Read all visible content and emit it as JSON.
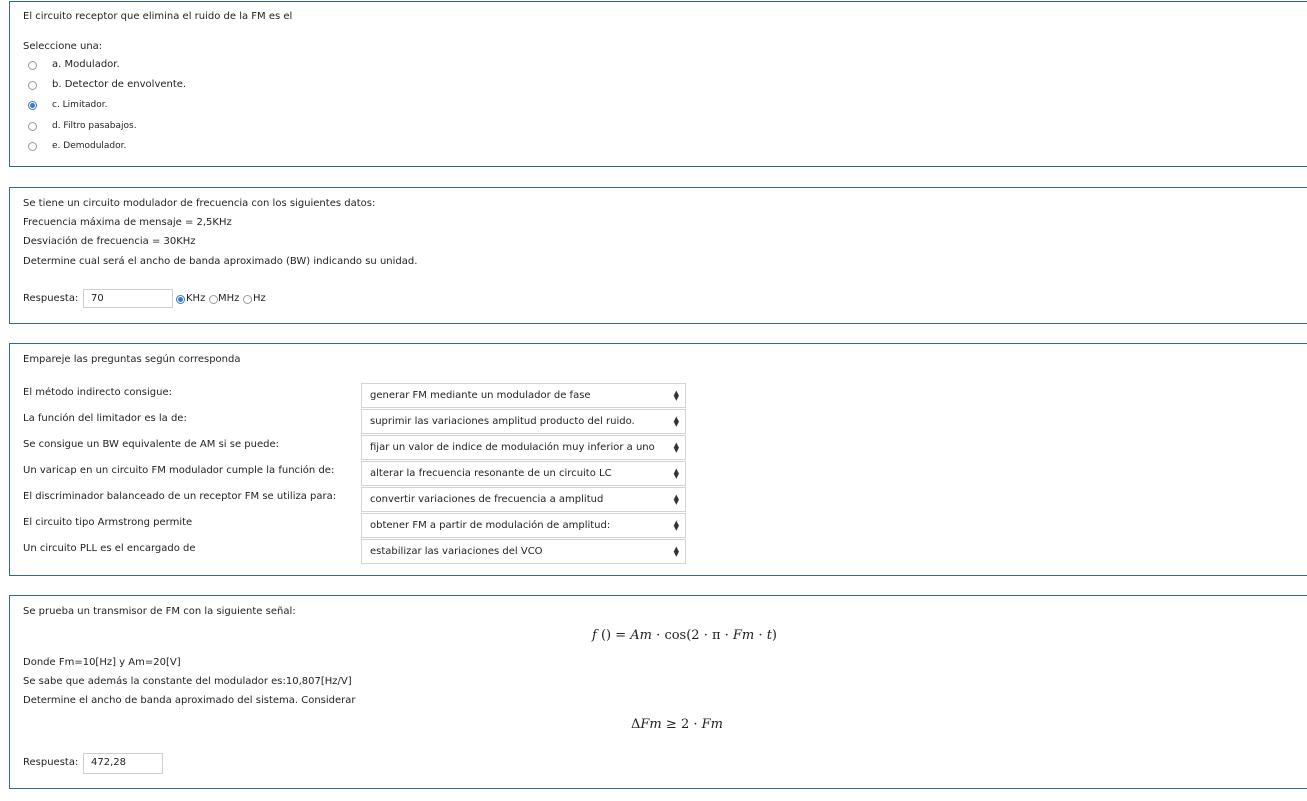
{
  "q1": {
    "prompt": "El circuito receptor que elimina el ruido de la FM es el",
    "select_label": "Seleccione una:",
    "options": [
      {
        "text": "a.  Modulador.",
        "selected": false
      },
      {
        "text": "b. Detector de envolvente.",
        "selected": false
      },
      {
        "text": "c.  Limitador.",
        "selected": true
      },
      {
        "text": "d. Filtro pasabajos.",
        "selected": false
      },
      {
        "text": "e.  Demodulador.",
        "selected": false
      }
    ]
  },
  "q2": {
    "lines": [
      "Se tiene un circuito modulador de frecuencia con los siguientes datos:",
      "Frecuencia máxima de mensaje = 2,5KHz",
      "Desviación de frecuencia = 30KHz",
      "Determine cual será el ancho de banda aproximado (BW) indicando su unidad."
    ],
    "answer_label": "Respuesta:",
    "answer_value": "70",
    "units": [
      {
        "text": "KHz",
        "selected": true
      },
      {
        "text": "MHz",
        "selected": false
      },
      {
        "text": "Hz",
        "selected": false
      }
    ]
  },
  "q3": {
    "prompt": "Empareje las preguntas según corresponda",
    "pairs": [
      {
        "question": "El método indirecto consigue:",
        "answer": "generar FM mediante un modulador de fase"
      },
      {
        "question": "La función del limitador es la de:",
        "answer": "suprimir las variaciones amplitud producto del ruido."
      },
      {
        "question": "Se consigue un BW equivalente de AM si se puede:",
        "answer": "fijar un valor de indice de modulación muy inferior a uno"
      },
      {
        "question": "Un varicap en un circuito FM modulador cumple la función de:",
        "answer": "alterar la frecuencia resonante de un circuito LC"
      },
      {
        "question": "El discriminador balanceado de un receptor FM se utiliza para:",
        "answer": "convertir variaciones de frecuencia a amplitud"
      },
      {
        "question": "El circuito tipo Armstrong permite",
        "answer": "obtener FM a partir de modulación de amplitud:"
      },
      {
        "question": "Un circuito PLL es el encargado de",
        "answer": "estabilizar las variaciones del VCO"
      }
    ]
  },
  "q4": {
    "intro": "Se prueba un transmisor de FM con la siguiente señal:",
    "formula1": {
      "f": "f",
      "paren": "()",
      "eq": "=",
      "Am": "Am",
      "dot": "·",
      "cos": "cos(2 · π · ",
      "Fm": "Fm",
      "dot2": "·",
      "t": "t",
      "close": ")"
    },
    "line_fm": "Donde Fm=10[Hz] y Am=20[V]",
    "line_k": "Se sabe que además la constante del modulador es:10,807[Hz/V]",
    "line_det": "Determine el ancho de banda aproximado del sistema. Considerar",
    "formula2": {
      "delta": "Δ",
      "Fm": "Fm",
      "ge": "≥",
      "two": "2 ·",
      "Fm2": "Fm"
    },
    "answer_label": "Respuesta:",
    "answer_value": "472,28"
  }
}
